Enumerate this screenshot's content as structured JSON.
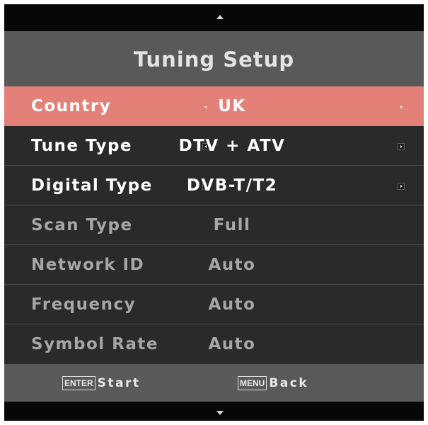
{
  "menu": {
    "title": "Tuning Setup",
    "rows": [
      {
        "label": "Country",
        "value": "UK",
        "selected": true,
        "enabled": true,
        "has_arrows": true
      },
      {
        "label": "Tune Type",
        "value": "DTV + ATV",
        "selected": false,
        "enabled": true,
        "has_arrows": true
      },
      {
        "label": "Digital Type",
        "value": "DVB-T/T2",
        "selected": false,
        "enabled": true,
        "has_arrows": true
      },
      {
        "label": "Scan Type",
        "value": "Full",
        "selected": false,
        "enabled": false,
        "has_arrows": false
      },
      {
        "label": "Network ID",
        "value": "Auto",
        "selected": false,
        "enabled": false,
        "has_arrows": false
      },
      {
        "label": "Frequency",
        "value": "Auto",
        "selected": false,
        "enabled": false,
        "has_arrows": false
      },
      {
        "label": "Symbol Rate",
        "value": "Auto",
        "selected": false,
        "enabled": false,
        "has_arrows": false
      }
    ]
  },
  "footer": {
    "enter_key": "ENTER",
    "enter_action": "Start",
    "menu_key": "MENU",
    "menu_action": "Back"
  },
  "icons": {
    "scroll_up": "triangle-up-icon",
    "scroll_down": "triangle-down-icon",
    "option_left": "arrow-left-icon",
    "option_right": "arrow-right-icon"
  },
  "colors": {
    "selected_row": "#e38178",
    "title_bar": "#595959",
    "panel": "#2a2a2a",
    "disabled_text": "#a6a6a6"
  }
}
